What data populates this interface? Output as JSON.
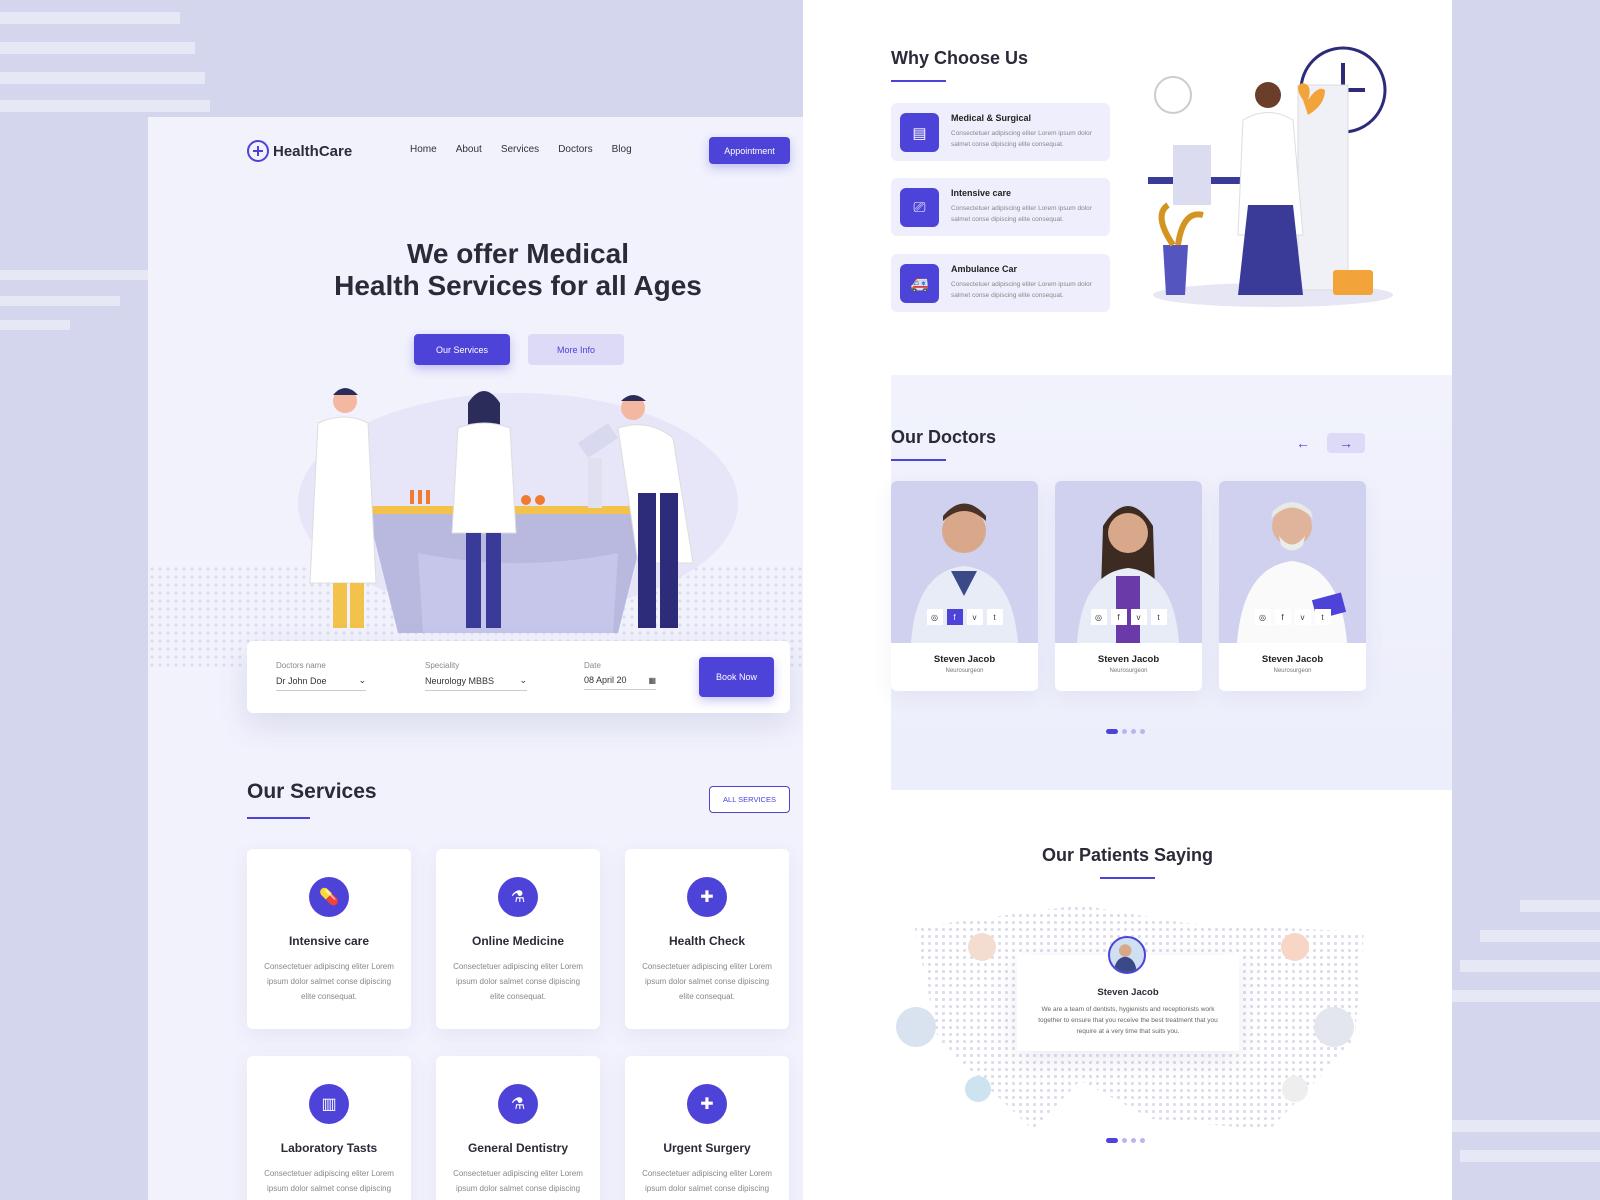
{
  "brand": {
    "name": "HealthCare"
  },
  "nav": {
    "items": [
      "Home",
      "About",
      "Services",
      "Doctors",
      "Blog"
    ],
    "cta": "Appointment"
  },
  "hero": {
    "title_line1": "We offer Medical",
    "title_line2": "Health Services for all Ages",
    "primary_btn": "Our Services",
    "secondary_btn": "More Info"
  },
  "booking": {
    "fields": [
      {
        "label": "Doctors name",
        "value": "Dr John Doe"
      },
      {
        "label": "Speciality",
        "value": "Neurology MBBS"
      },
      {
        "label": "Date",
        "value": "08 April 20"
      }
    ],
    "button": "Book Now"
  },
  "services": {
    "title": "Our Services",
    "all_btn": "ALL SERVICES",
    "desc": "Consectetuer adipiscing eliter Lorem ipsum dolor salmet conse dipiscing elite consequat.",
    "items": [
      {
        "name": "Intensive care",
        "icon": "pills-icon"
      },
      {
        "name": "Online Medicine",
        "icon": "test-tubes-icon"
      },
      {
        "name": "Health Check",
        "icon": "shield-plus-icon"
      },
      {
        "name": "Laboratory Tasts",
        "icon": "lab-rack-icon"
      },
      {
        "name": "General Dentistry",
        "icon": "test-tubes-icon"
      },
      {
        "name": "Urgent Surgery",
        "icon": "shield-plus-icon"
      }
    ]
  },
  "why": {
    "title": "Why Choose Us",
    "desc": "Consectetuer adipiscing eliter Lorem ipsum dolor salmet conse dipiscing elite consequat.",
    "items": [
      {
        "name": "Medical & Surgical",
        "icon": "hospital-icon"
      },
      {
        "name": "Intensive care",
        "icon": "monitor-icon"
      },
      {
        "name": "Ambulance Car",
        "icon": "ambulance-icon"
      }
    ]
  },
  "doctors": {
    "title": "Our Doctors",
    "prev": "←",
    "next": "→",
    "social": [
      "instagram-icon",
      "facebook-icon",
      "vimeo-icon",
      "twitter-icon"
    ],
    "social_glyphs": [
      "◎",
      "f",
      "v",
      "t"
    ],
    "items": [
      {
        "name": "Steven Jacob",
        "role": "Neurosurgeon"
      },
      {
        "name": "Steven Jacob",
        "role": "Neurosurgeon"
      },
      {
        "name": "Steven Jacob",
        "role": "Neurosurgeon"
      }
    ]
  },
  "testimonials": {
    "title": "Our Patients Saying",
    "name": "Steven Jacob",
    "text": "We are a team of dentists, hygienists and receptionists work together to ensure that you receive the best treatment that you require at a very time that suits you."
  },
  "colors": {
    "accent": "#4e43d8",
    "soft": "#dcdaf7",
    "panel": "#f1f2fc"
  }
}
